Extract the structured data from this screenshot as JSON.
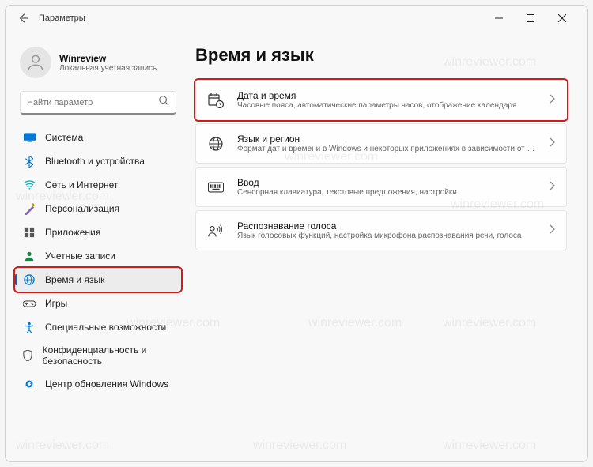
{
  "window": {
    "title": "Параметры"
  },
  "profile": {
    "name": "Winreview",
    "subtitle": "Локальная учетная запись"
  },
  "search": {
    "placeholder": "Найти параметр"
  },
  "sidebar": {
    "items": [
      {
        "label": "Система",
        "icon": "system",
        "color": "#0078d4"
      },
      {
        "label": "Bluetooth и устройства",
        "icon": "bluetooth",
        "color": "#0078d4"
      },
      {
        "label": "Сеть и Интернет",
        "icon": "network",
        "color": "#00b7c3"
      },
      {
        "label": "Персонализация",
        "icon": "personalization",
        "color": "#8764b8"
      },
      {
        "label": "Приложения",
        "icon": "apps",
        "color": "#555"
      },
      {
        "label": "Учетные записи",
        "icon": "accounts",
        "color": "#10893e"
      },
      {
        "label": "Время и язык",
        "icon": "time-language",
        "color": "#0078d4",
        "active": true,
        "highlight": true
      },
      {
        "label": "Игры",
        "icon": "gaming",
        "color": "#555"
      },
      {
        "label": "Специальные возможности",
        "icon": "accessibility",
        "color": "#0078d4"
      },
      {
        "label": "Конфиденциальность и безопасность",
        "icon": "privacy",
        "color": "#555"
      },
      {
        "label": "Центр обновления Windows",
        "icon": "update",
        "color": "#0078d4"
      }
    ]
  },
  "main": {
    "heading": "Время и язык",
    "cards": [
      {
        "title": "Дата и время",
        "subtitle": "Часовые пояса, автоматические параметры часов, отображение календаря",
        "icon": "date-time",
        "highlight": true
      },
      {
        "title": "Язык и регион",
        "subtitle": "Формат дат и времени в Windows и некоторых приложениях в зависимости от региона",
        "icon": "language-region"
      },
      {
        "title": "Ввод",
        "subtitle": "Сенсорная клавиатура, текстовые предложения, настройки",
        "icon": "typing"
      },
      {
        "title": "Распознавание голоса",
        "subtitle": "Язык голосовых функций, настройка микрофона распознавания речи, голоса",
        "icon": "speech"
      }
    ]
  },
  "watermark": "winreviewer.com"
}
